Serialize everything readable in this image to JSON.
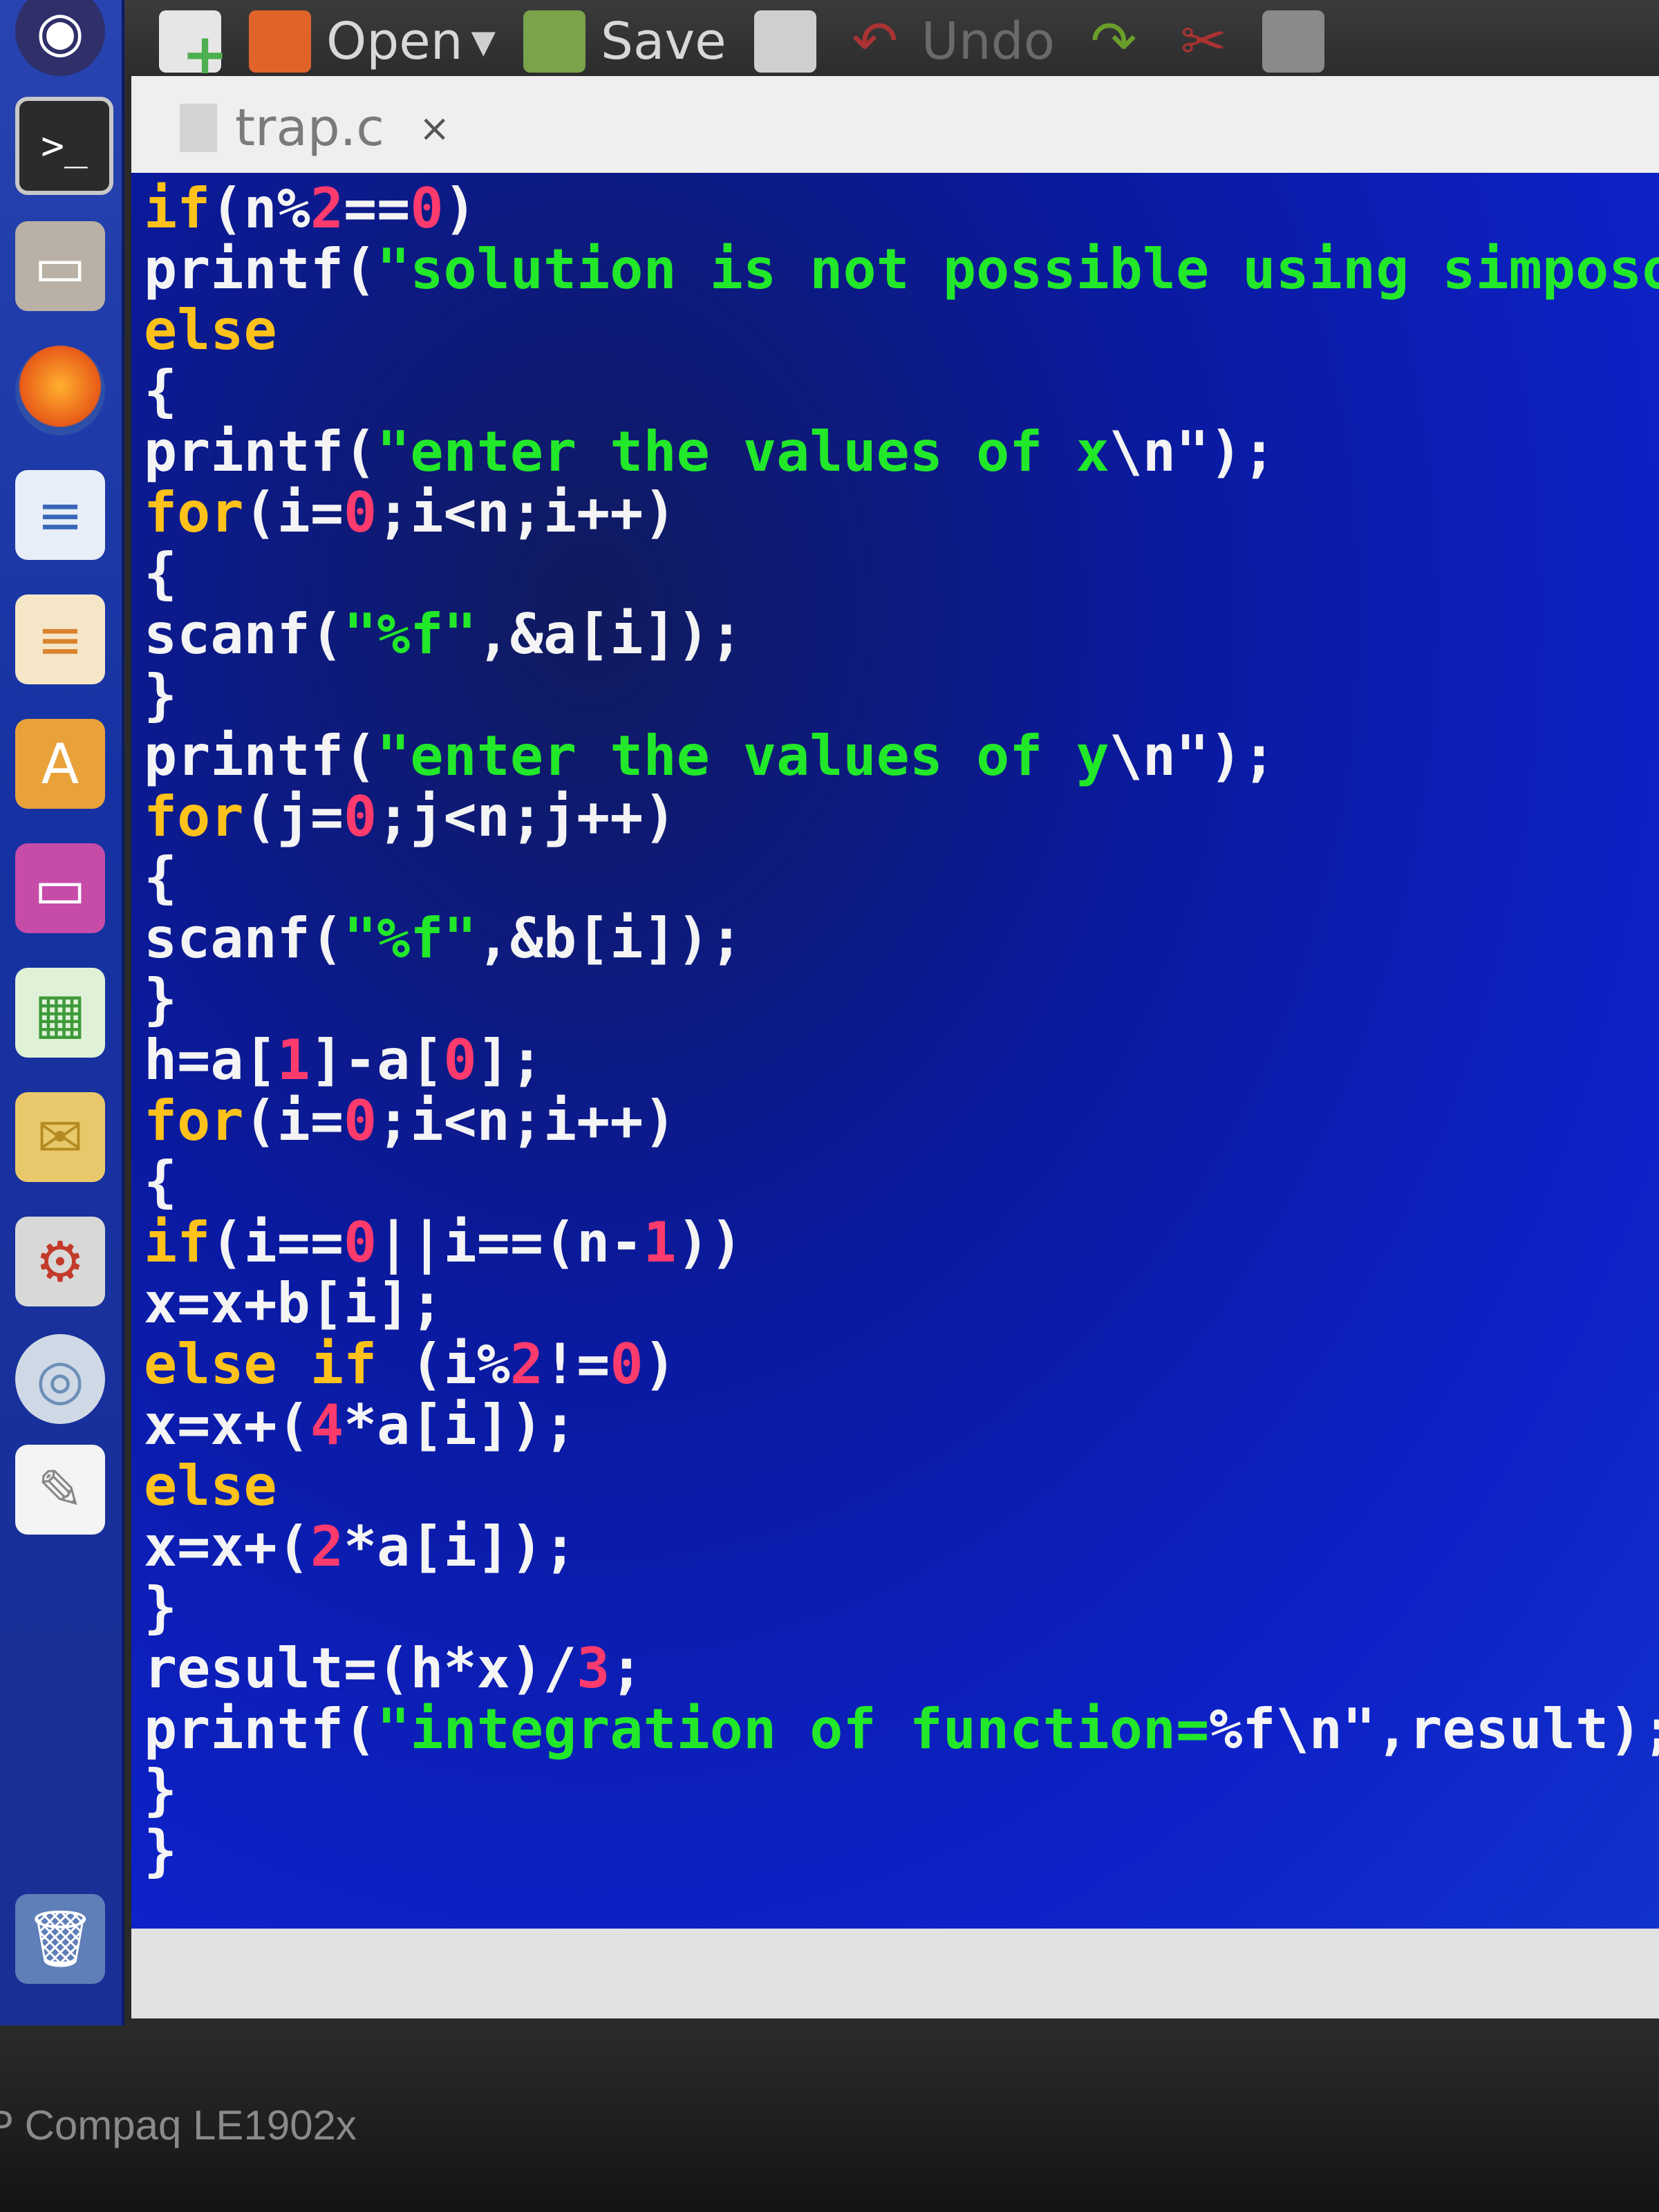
{
  "toolbar": {
    "open_label": "Open",
    "save_label": "Save",
    "undo_label": "Undo"
  },
  "tab": {
    "filename": "trap.c",
    "close": "×"
  },
  "code": {
    "l1": {
      "a": "if",
      "b": "(n%",
      "c": "2",
      "d": "==",
      "e": "0",
      "f": ")"
    },
    "l2": {
      "a": "printf(",
      "b": "\"solution is not possible using simposon\""
    },
    "l3": "else",
    "l4": "{",
    "l5": {
      "a": "printf(",
      "b": "\"enter the values of x",
      "c": "\\n\");"
    },
    "l6": {
      "a": "for",
      "b": "(i=",
      "c": "0",
      "d": ";i<n;i++)"
    },
    "l7": "{",
    "l8": {
      "a": "scanf(",
      "b": "\"%f\"",
      "c": ",&a[i]);"
    },
    "l9": "}",
    "l10": {
      "a": "printf(",
      "b": "\"enter the values of y",
      "c": "\\n\");"
    },
    "l11": {
      "a": "for",
      "b": "(j=",
      "c": "0",
      "d": ";j<n;j++)"
    },
    "l12": "{",
    "l13": {
      "a": "scanf(",
      "b": "\"%f\"",
      "c": ",&b[i]);"
    },
    "l14": "}",
    "l15": {
      "a": "h=a[",
      "b": "1",
      "c": "]-a[",
      "d": "0",
      "e": "];"
    },
    "l16": {
      "a": "for",
      "b": "(i=",
      "c": "0",
      "d": ";i<n;i++)"
    },
    "l17": "{",
    "l18": {
      "a": "if",
      "b": "(i==",
      "c": "0",
      "d": "||i==(n-",
      "e": "1",
      "f": "))"
    },
    "l19": "x=x+b[i];",
    "l20": {
      "a": "else if",
      "b": " (i%",
      "c": "2",
      "d": "!=",
      "e": "0",
      "f": ")"
    },
    "l21": {
      "a": "x=x+(",
      "b": "4",
      "c": "*a[i]);"
    },
    "l22": "else",
    "l23": {
      "a": "x=x+(",
      "b": "2",
      "c": "*a[i]);"
    },
    "l24": "}",
    "l25": {
      "a": "result=(h*x)/",
      "b": "3",
      "c": ";"
    },
    "l26": {
      "a": "printf(",
      "b": "\"integration of function=",
      "c": "%f\\n\"",
      "d": ",result);"
    },
    "l27": "}",
    "l28": "}"
  },
  "monitor": {
    "brand": "P Compaq LE1902x"
  },
  "icons": {
    "dash": "ubuntu-dash-icon",
    "terminal": "terminal-icon",
    "files": "files-icon",
    "firefox": "firefox-icon",
    "writer": "writer-icon",
    "impress": "impress-icon",
    "software_center": "software-center-icon",
    "ubuntu_one": "ubuntu-one-icon",
    "calc": "calc-icon",
    "mail": "mail-icon",
    "settings": "settings-icon",
    "disc": "disc-icon",
    "gedit": "text-editor-icon",
    "trash": "trash-icon"
  }
}
